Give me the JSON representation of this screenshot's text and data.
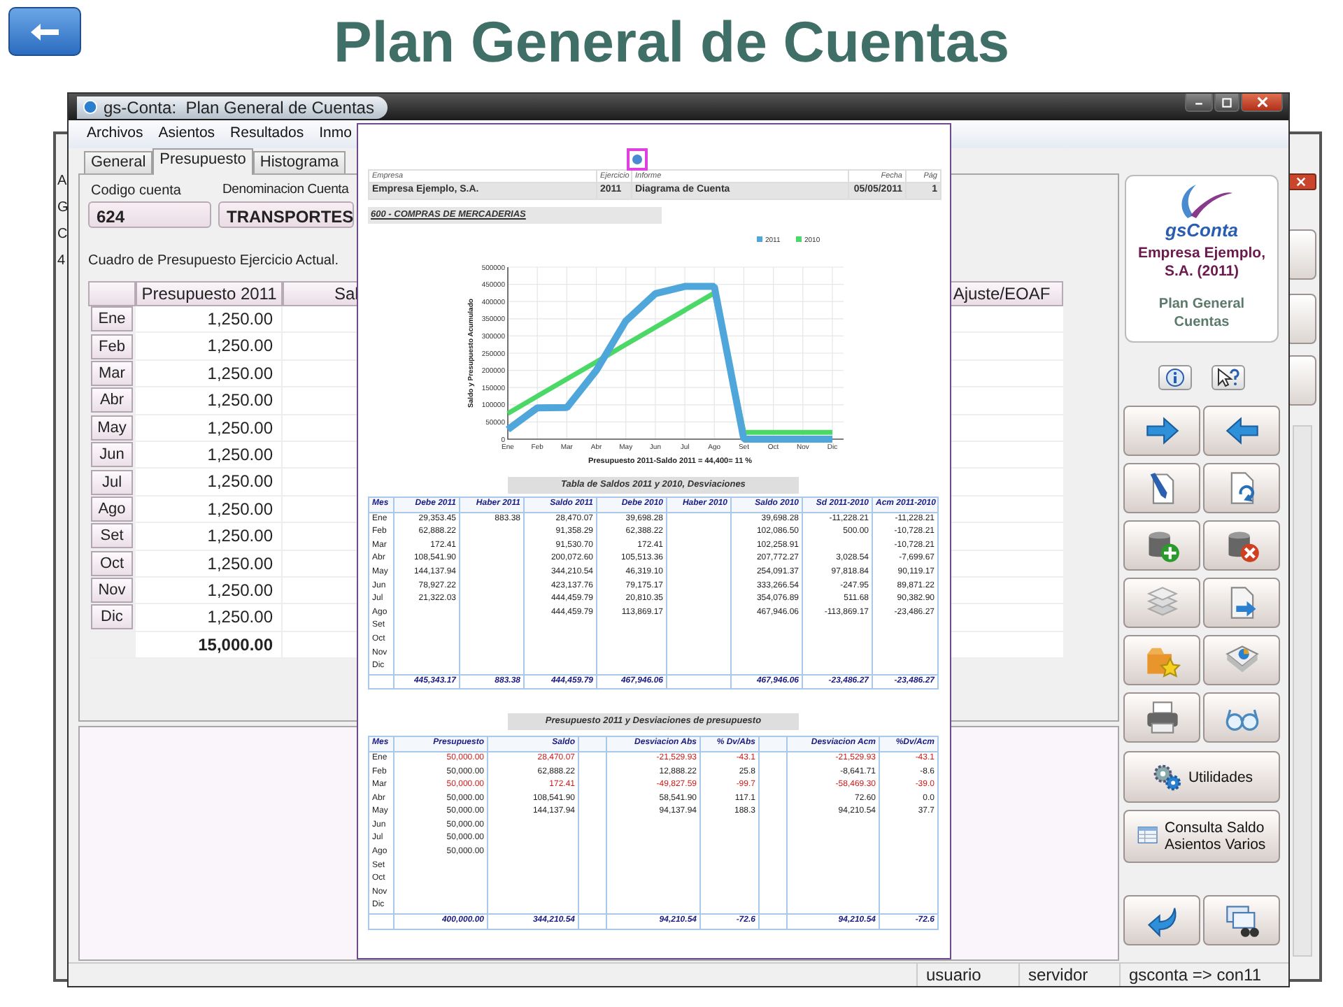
{
  "slide": {
    "title": "Plan General de Cuentas"
  },
  "back_window": {
    "fragments": [
      "A",
      "G",
      "C",
      "4"
    ]
  },
  "window": {
    "title": "gs-Conta:  Plan General de Cuentas"
  },
  "menu": [
    "Archivos",
    "Asientos",
    "Resultados",
    "Inmo"
  ],
  "tabs": [
    {
      "label": "General",
      "selected": false
    },
    {
      "label": "Presupuesto",
      "selected": true
    },
    {
      "label": "Histograma",
      "selected": false
    }
  ],
  "fields": [
    {
      "label": "Codigo cuenta",
      "value": "624"
    },
    {
      "label": "Denominacion Cuenta",
      "value": "TRANSPORTES"
    }
  ],
  "budget_grid": {
    "caption": "Cuadro de Presupuesto Ejercicio Actual.",
    "columns": [
      "Presupuesto 2011",
      "Sal",
      "Ajuste/EOAF"
    ],
    "rows": [
      {
        "month": "Ene",
        "budget": "1,250.00"
      },
      {
        "month": "Feb",
        "budget": "1,250.00"
      },
      {
        "month": "Mar",
        "budget": "1,250.00"
      },
      {
        "month": "Abr",
        "budget": "1,250.00"
      },
      {
        "month": "May",
        "budget": "1,250.00"
      },
      {
        "month": "Jun",
        "budget": "1,250.00"
      },
      {
        "month": "Jul",
        "budget": "1,250.00"
      },
      {
        "month": "Ago",
        "budget": "1,250.00"
      },
      {
        "month": "Set",
        "budget": "1,250.00"
      },
      {
        "month": "Oct",
        "budget": "1,250.00"
      },
      {
        "month": "Nov",
        "budget": "1,250.00"
      },
      {
        "month": "Dic",
        "budget": "1,250.00"
      }
    ],
    "total": "15,000.00"
  },
  "report": {
    "header": {
      "labels": [
        "Empresa",
        "Ejercicio",
        "Informe",
        "Fecha",
        "Pág"
      ],
      "values": [
        "Empresa Ejemplo, S.A.",
        "2011",
        "Diagrama de Cuenta",
        "05/05/2011",
        "1"
      ]
    },
    "account": "600 - COMPRAS DE MERCADERIAS",
    "chart_data": {
      "type": "line",
      "xlabel": "Presupuesto 2011-Saldo 2011 = 44,400= 11 %",
      "ylabel": "Saldo y Presupuesto Acumulado",
      "grid": true,
      "legend": true,
      "categories": [
        "Ene",
        "Feb",
        "Mar",
        "Abr",
        "May",
        "Jun",
        "Jul",
        "Ago",
        "Set",
        "Oct",
        "Nov",
        "Dic"
      ],
      "ylim": [
        0,
        500000
      ],
      "yticks": [
        0,
        50000,
        100000,
        150000,
        200000,
        250000,
        300000,
        350000,
        400000,
        450000,
        500000
      ],
      "series": [
        {
          "name": "2011",
          "color": "#4fa6da",
          "values": [
            28000,
            91000,
            92000,
            200000,
            344000,
            423000,
            444000,
            444000,
            0,
            0,
            0,
            0
          ]
        },
        {
          "name": "2010",
          "color": "#4cd866",
          "values": [
            75000,
            125000,
            175000,
            225000,
            275000,
            325000,
            375000,
            425000,
            20000,
            20000,
            20000,
            20000
          ]
        }
      ]
    },
    "balances": {
      "title": "Tabla de Saldos 2011 y 2010, Desviaciones",
      "columns": [
        "Mes",
        "Debe 2011",
        "Haber 2011",
        "Saldo 2011",
        "Debe 2010",
        "Haber 2010",
        "Saldo 2010",
        "Sd 2011-2010",
        "Acm 2011-2010"
      ],
      "rows": [
        [
          "Ene",
          "29,353.45",
          "883.38",
          "28,470.07",
          "39,698.28",
          null,
          "39,698.28",
          "-11,228.21",
          "-11,228.21"
        ],
        [
          "Feb",
          "62,888.22",
          null,
          "91,358.29",
          "62,388.22",
          null,
          "102,086.50",
          "500.00",
          "-10,728.21"
        ],
        [
          "Mar",
          "172.41",
          null,
          "91,530.70",
          "172.41",
          null,
          "102,258.91",
          null,
          "-10,728.21"
        ],
        [
          "Abr",
          "108,541.90",
          null,
          "200,072.60",
          "105,513.36",
          null,
          "207,772.27",
          "3,028.54",
          "-7,699.67"
        ],
        [
          "May",
          "144,137.94",
          null,
          "344,210.54",
          "46,319.10",
          null,
          "254,091.37",
          "97,818.84",
          "90,119.17"
        ],
        [
          "Jun",
          "78,927.22",
          null,
          "423,137.76",
          "79,175.17",
          null,
          "333,266.54",
          "-247.95",
          "89,871.22"
        ],
        [
          "Jul",
          "21,322.03",
          null,
          "444,459.79",
          "20,810.35",
          null,
          "354,076.89",
          "511.68",
          "90,382.90"
        ],
        [
          "Ago",
          null,
          null,
          "444,459.79",
          "113,869.17",
          null,
          "467,946.06",
          "-113,869.17",
          "-23,486.27"
        ],
        [
          "Set",
          null,
          null,
          null,
          null,
          null,
          null,
          null,
          null
        ],
        [
          "Oct",
          null,
          null,
          null,
          null,
          null,
          null,
          null,
          null
        ],
        [
          "Nov",
          null,
          null,
          null,
          null,
          null,
          null,
          null,
          null
        ],
        [
          "Dic",
          null,
          null,
          null,
          null,
          null,
          null,
          null,
          null
        ]
      ],
      "totals": {
        "debe_2011": "445,343.17",
        "haber_2011": "883.38",
        "saldo_2011": "444,459.79",
        "debe_2010": "467,946.06",
        "saldo_2010": "467,946.06",
        "sd_2011_2010": "-23,486.27",
        "acm_2011_2010": "-23,486.27"
      }
    },
    "deviations": {
      "title": "Presupuesto 2011 y Desviaciones de presupuesto",
      "columns": [
        "Mes",
        "Presupuesto",
        "Saldo",
        "Desviacion Abs",
        "% Dv/Abs",
        "Desviacion Acm",
        "%Dv/Acm"
      ],
      "rows": [
        {
          "alert": true,
          "cells": [
            "Ene",
            "50,000.00",
            "28,470.07",
            "-21,529.93",
            "-43.1",
            "-21,529.93",
            "-43.1"
          ]
        },
        {
          "alert": false,
          "cells": [
            "Feb",
            "50,000.00",
            "62,888.22",
            "12,888.22",
            "25.8",
            "-8,641.71",
            "-8.6"
          ]
        },
        {
          "alert": true,
          "cells": [
            "Mar",
            "50,000.00",
            "172.41",
            "-49,827.59",
            "-99.7",
            "-58,469.30",
            "-39.0"
          ]
        },
        {
          "alert": false,
          "cells": [
            "Abr",
            "50,000.00",
            "108,541.90",
            "58,541.90",
            "117.1",
            "72.60",
            "0.0"
          ]
        },
        {
          "alert": false,
          "cells": [
            "May",
            "50,000.00",
            "144,137.94",
            "94,137.94",
            "188.3",
            "94,210.54",
            "37.7"
          ]
        },
        {
          "alert": false,
          "cells": [
            "Jun",
            "50,000.00",
            null,
            null,
            null,
            null,
            null
          ]
        },
        {
          "alert": false,
          "cells": [
            "Jul",
            "50,000.00",
            null,
            null,
            null,
            null,
            null
          ]
        },
        {
          "alert": false,
          "cells": [
            "Ago",
            "50,000.00",
            null,
            null,
            null,
            null,
            null
          ]
        },
        {
          "cells": [
            "Set",
            null,
            null,
            null,
            null,
            null,
            null
          ]
        },
        {
          "cells": [
            "Oct",
            null,
            null,
            null,
            null,
            null,
            null
          ]
        },
        {
          "cells": [
            "Nov",
            null,
            null,
            null,
            null,
            null,
            null
          ]
        },
        {
          "cells": [
            "Dic",
            null,
            null,
            null,
            null,
            null,
            null
          ]
        }
      ],
      "totals": {
        "presupuesto": "400,000.00",
        "saldo": "344,210.54",
        "desviacion_abs": "94,210.54",
        "dv_abs": "-72.6",
        "desviacion_acm": "94,210.54",
        "dv_acm": "-72.6"
      }
    }
  },
  "side_panel": {
    "logo": "gsConta",
    "company": "Empresa Ejemplo, S.A. (2011)",
    "module": "Plan General Cuentas",
    "buttons": [
      "Utilidades",
      "Consulta Saldo Asientos Varios"
    ]
  },
  "status_bar": [
    "usuario",
    "servidor",
    "gsconta => con11"
  ]
}
